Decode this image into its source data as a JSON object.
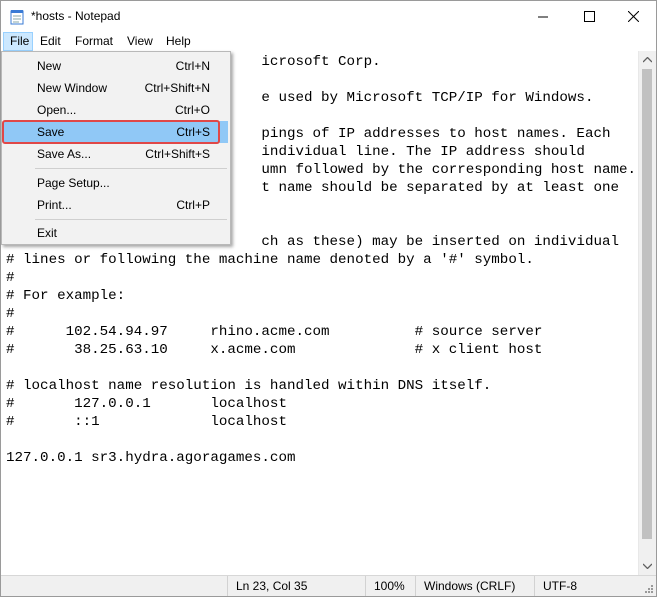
{
  "window": {
    "title": "*hosts - Notepad",
    "icon": "notepad-icon"
  },
  "menubar": {
    "file": "File",
    "edit": "Edit",
    "format": "Format",
    "view": "View",
    "help": "Help"
  },
  "file_menu": {
    "items": [
      {
        "label": "New",
        "shortcut": "Ctrl+N"
      },
      {
        "label": "New Window",
        "shortcut": "Ctrl+Shift+N"
      },
      {
        "label": "Open...",
        "shortcut": "Ctrl+O"
      },
      {
        "label": "Save",
        "shortcut": "Ctrl+S"
      },
      {
        "label": "Save As...",
        "shortcut": "Ctrl+Shift+S"
      },
      {
        "label": "Page Setup...",
        "shortcut": ""
      },
      {
        "label": "Print...",
        "shortcut": "Ctrl+P"
      },
      {
        "label": "Exit",
        "shortcut": ""
      }
    ],
    "highlighted": "Save"
  },
  "editor": {
    "visible_text": "                              icrosoft Corp.\n\n                              e used by Microsoft TCP/IP for Windows.\n\n                              pings of IP addresses to host names. Each\n                              individual line. The IP address should\n                              umn followed by the corresponding host name.\n                              t name should be separated by at least one\n\n\n                              ch as these) may be inserted on individual\n# lines or following the machine name denoted by a '#' symbol.\n#\n# For example:\n#\n#      102.54.94.97     rhino.acme.com          # source server\n#       38.25.63.10     x.acme.com              # x client host\n\n# localhost name resolution is handled within DNS itself.\n#       127.0.0.1       localhost\n#       ::1             localhost\n\n127.0.0.1 sr3.hydra.agoragames.com"
  },
  "statusbar": {
    "position": "Ln 23, Col 35",
    "zoom": "100%",
    "line_ending": "Windows (CRLF)",
    "encoding": "UTF-8"
  },
  "colors": {
    "menu_highlight": "#90c8f6",
    "annotation_box": "#e04848",
    "menu_bg": "#f2f2f2",
    "active_menu_header": "#cce8ff"
  }
}
